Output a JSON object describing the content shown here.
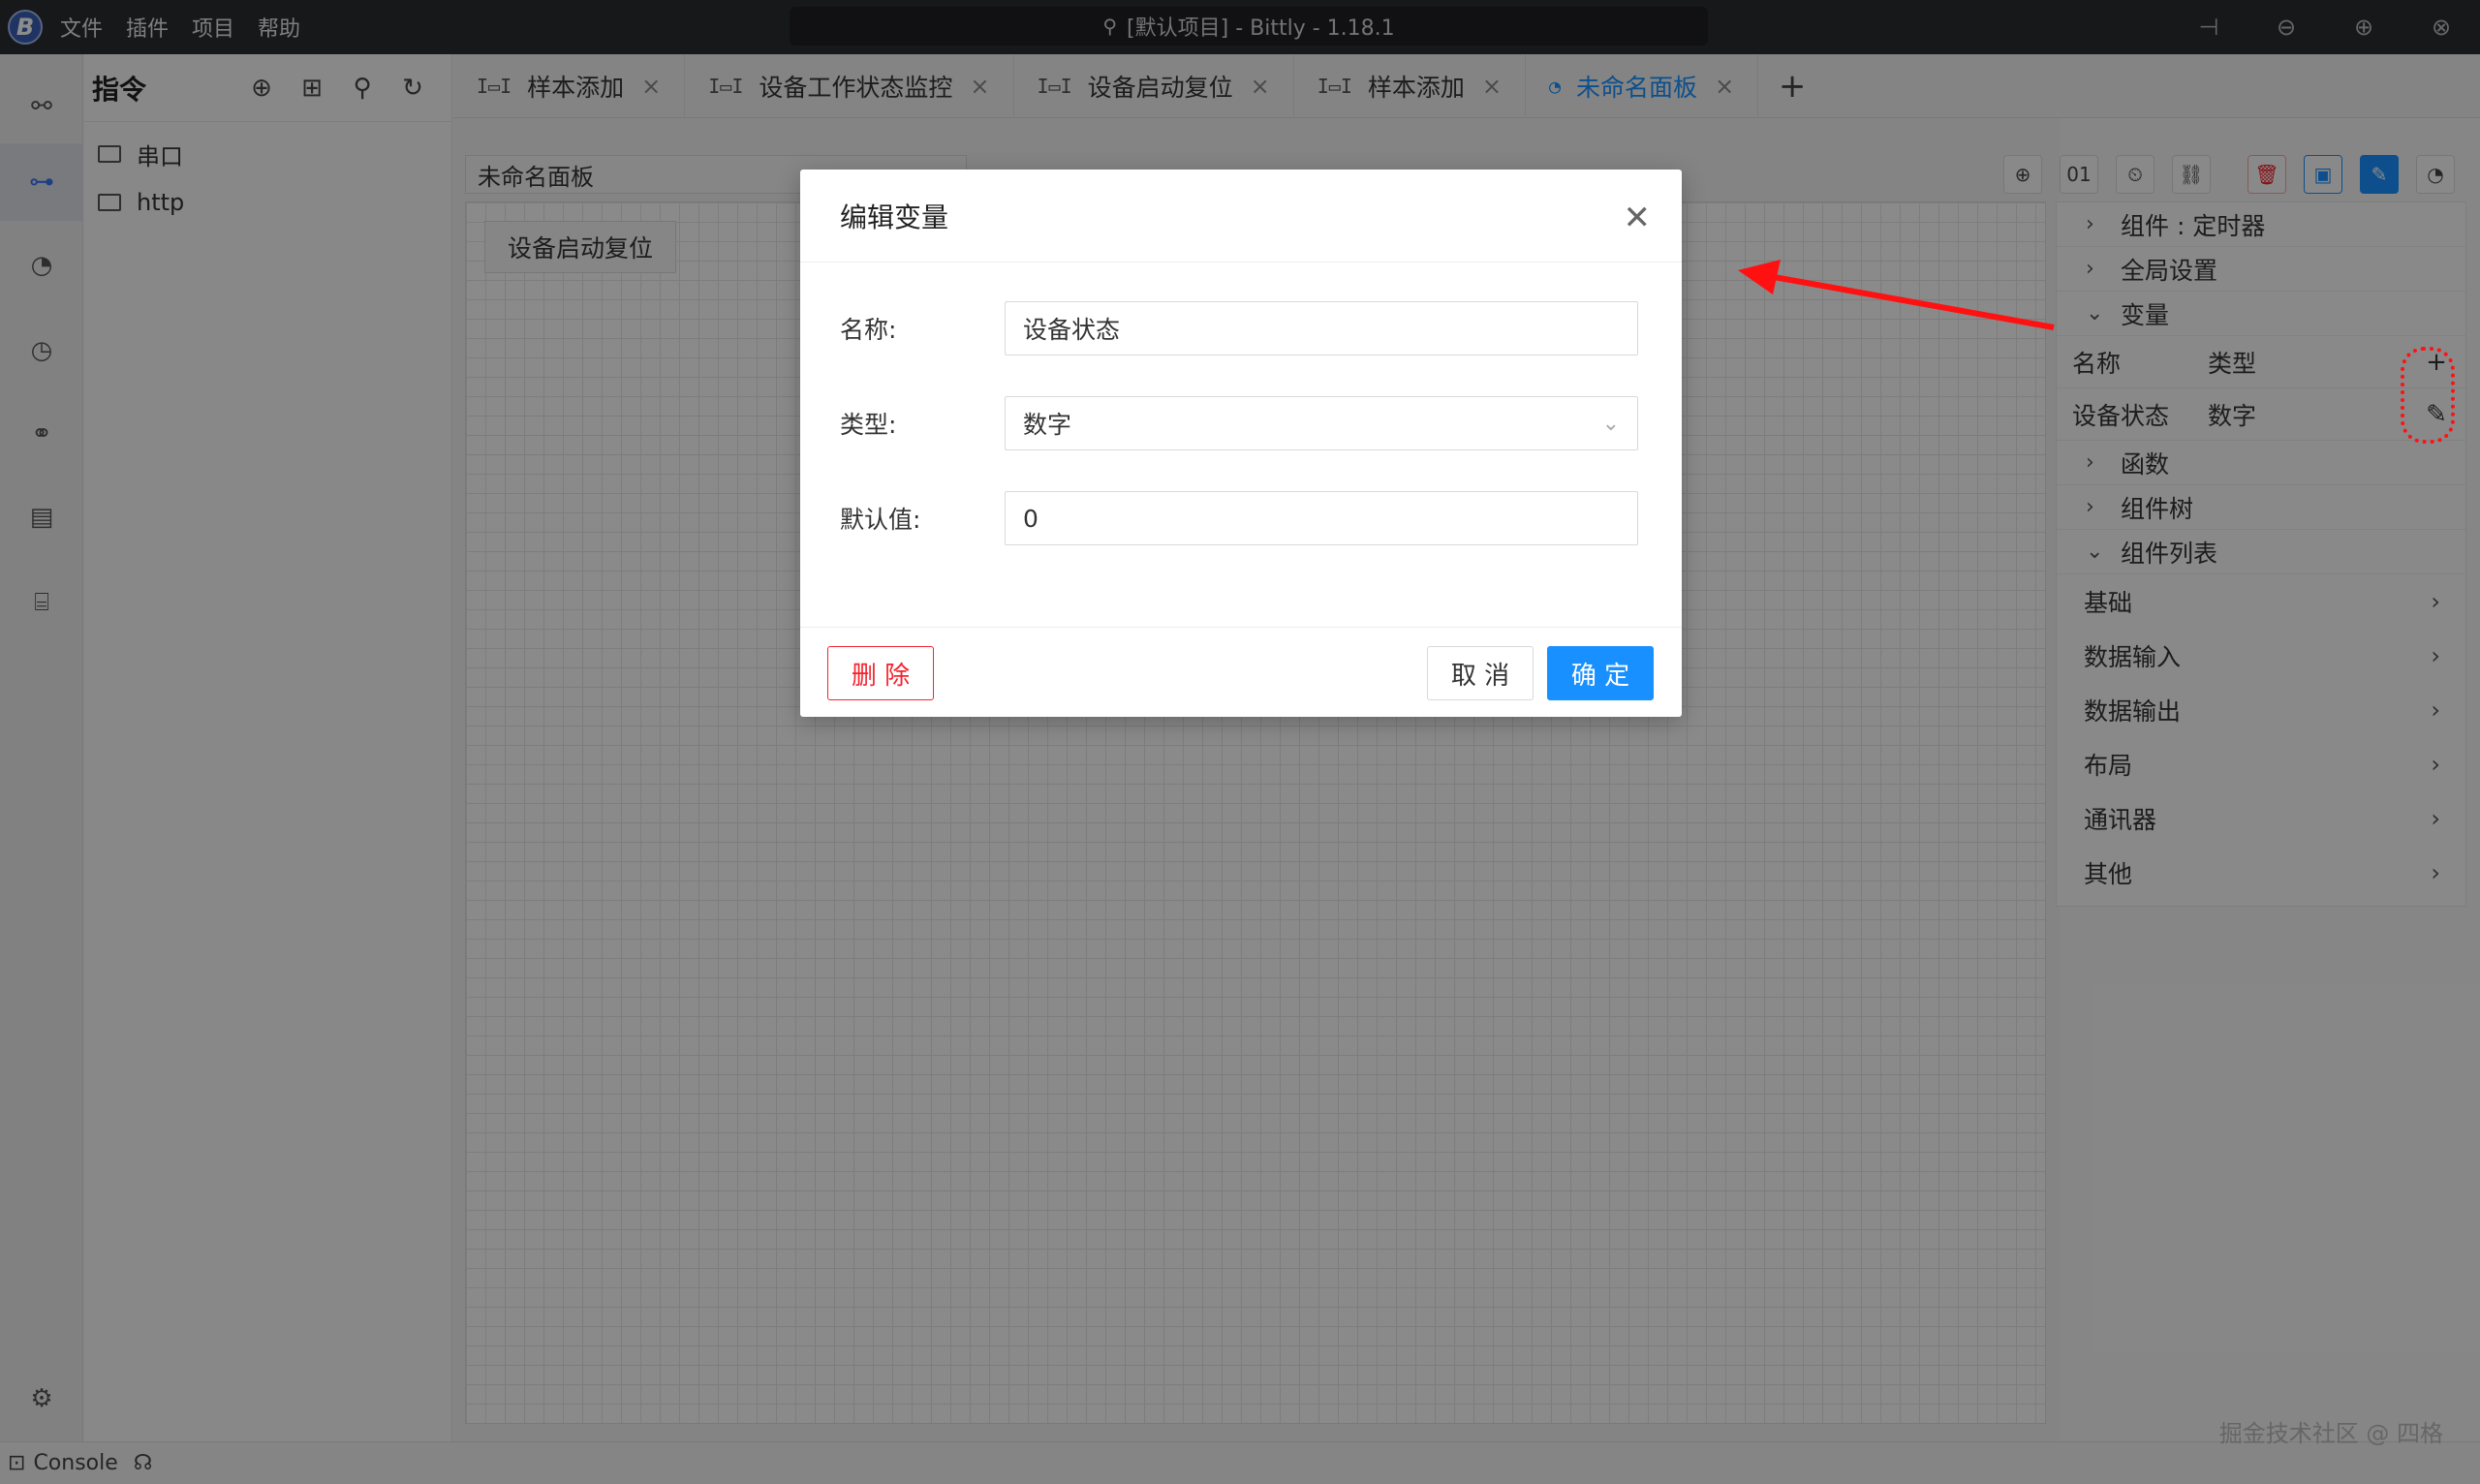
{
  "window": {
    "title": "[默认项目] - Bittly - 1.18.1",
    "menu": [
      "文件",
      "插件",
      "项目",
      "帮助"
    ]
  },
  "explorer": {
    "title": "指令",
    "items": [
      "串口",
      "http"
    ]
  },
  "tabs": [
    {
      "label": "样本添加",
      "active": false
    },
    {
      "label": "设备工作状态监控",
      "active": false
    },
    {
      "label": "设备启动复位",
      "active": false
    },
    {
      "label": "样本添加",
      "active": false
    },
    {
      "label": "未命名面板",
      "active": true
    }
  ],
  "panel": {
    "name": "未命名面板",
    "canvas_button": "设备启动复位",
    "toolbar_text": "01"
  },
  "right_panel": {
    "sections": {
      "component": "组件 : 定时器",
      "global": "全局设置",
      "variables": "变量",
      "functions": "函数",
      "tree": "组件树",
      "list": "组件列表"
    },
    "var_headers": {
      "name": "名称",
      "type": "类型"
    },
    "variables": [
      {
        "name": "设备状态",
        "type": "数字"
      }
    ],
    "categories": [
      "基础",
      "数据输入",
      "数据输出",
      "布局",
      "通讯器",
      "其他"
    ]
  },
  "modal": {
    "title": "编辑变量",
    "fields": {
      "name_label": "名称:",
      "name_value": "设备状态",
      "type_label": "类型:",
      "type_value": "数字",
      "default_label": "默认值:",
      "default_value": "0"
    },
    "buttons": {
      "delete": "删 除",
      "cancel": "取 消",
      "ok": "确 定"
    }
  },
  "statusbar": {
    "console": "Console"
  },
  "watermark": "掘金技术社区 @ 四格",
  "colors": {
    "primary": "#1890ff",
    "danger": "#f5222d",
    "annotation": "#ff1111"
  }
}
